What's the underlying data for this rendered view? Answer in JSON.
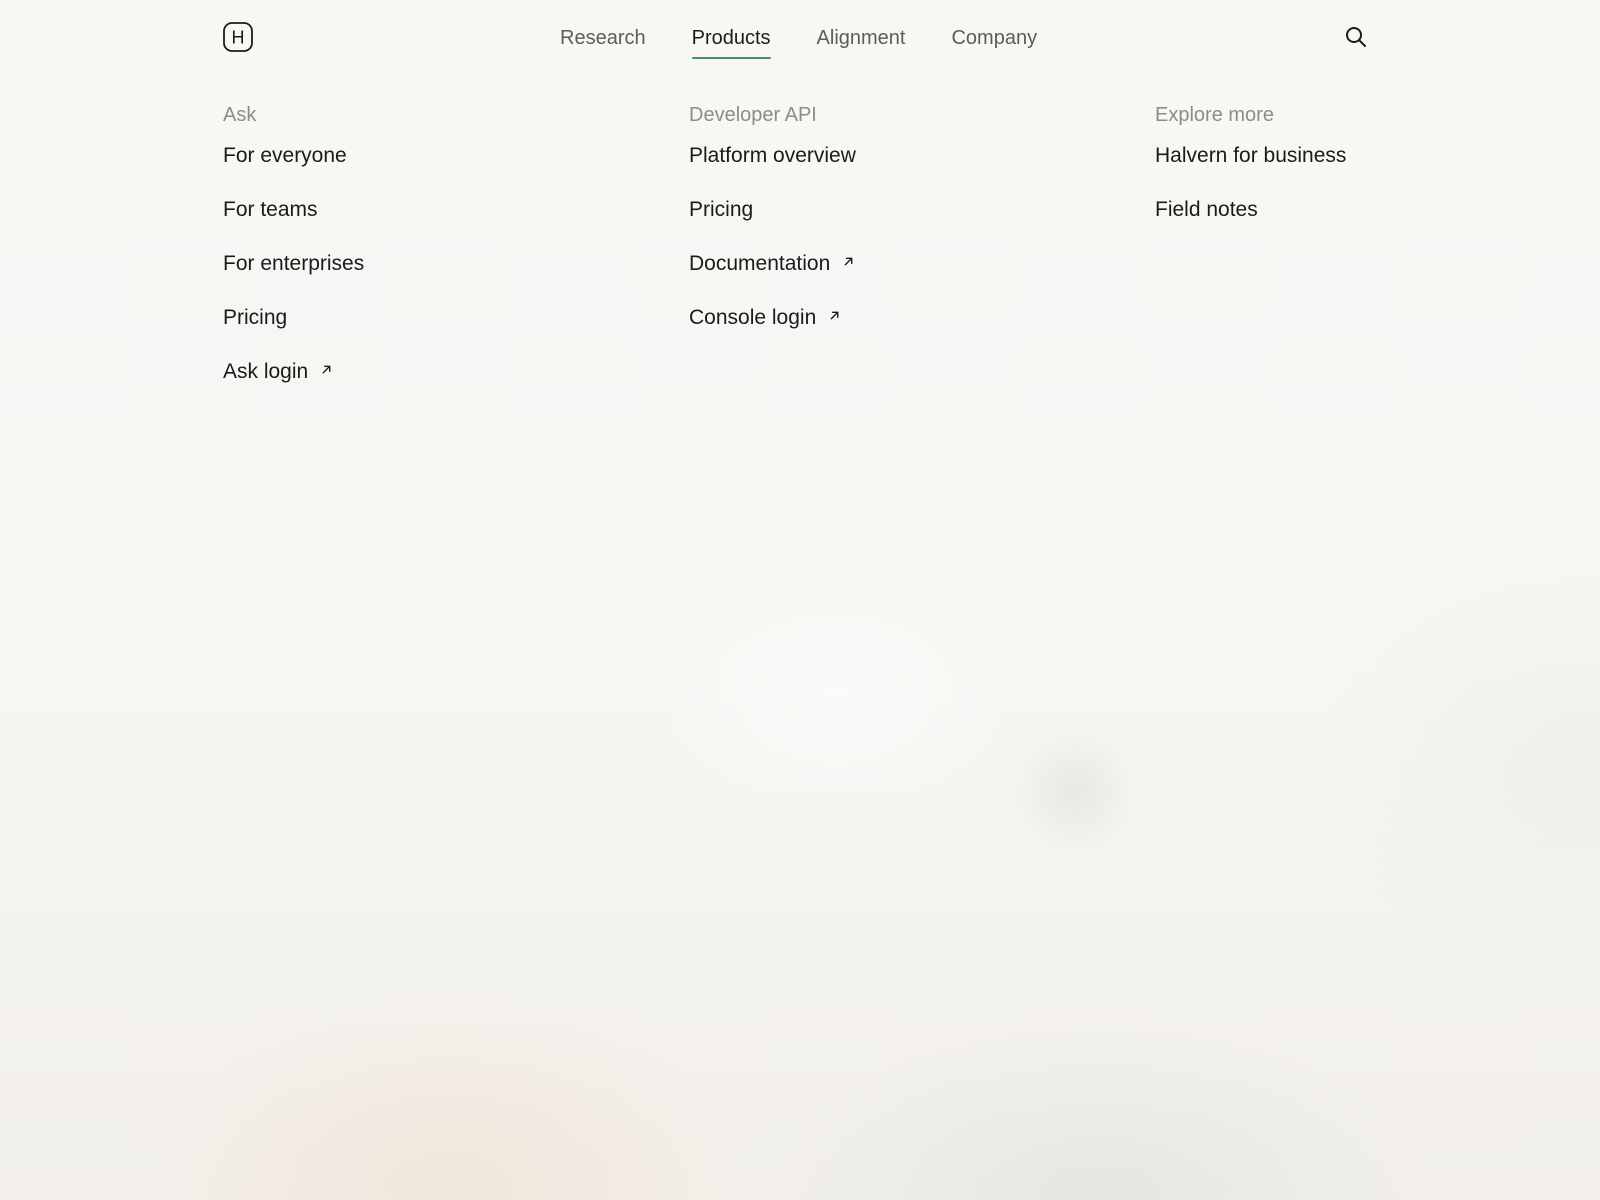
{
  "brand": {
    "logo_letter": "H"
  },
  "nav": {
    "items": [
      {
        "label": "Research",
        "active": false
      },
      {
        "label": "Products",
        "active": true
      },
      {
        "label": "Alignment",
        "active": false
      },
      {
        "label": "Company",
        "active": false
      }
    ],
    "search_icon": "search-icon",
    "accent_color": "#4f8a6d"
  },
  "menu": {
    "columns": [
      {
        "heading": "Ask",
        "links": [
          {
            "label": "For everyone",
            "external": false
          },
          {
            "label": "For teams",
            "external": false
          },
          {
            "label": "For enterprises",
            "external": false
          },
          {
            "label": "Pricing",
            "external": false
          },
          {
            "label": "Ask login",
            "external": true
          }
        ]
      },
      {
        "heading": "Developer API",
        "links": [
          {
            "label": "Platform overview",
            "external": false
          },
          {
            "label": "Pricing",
            "external": false
          },
          {
            "label": "Documentation",
            "external": true
          },
          {
            "label": "Console login",
            "external": true
          }
        ]
      },
      {
        "heading": "Explore more",
        "links": [
          {
            "label": "Halvern for business",
            "external": false
          },
          {
            "label": "Field notes",
            "external": false
          }
        ]
      }
    ],
    "external_icon": "external-link-arrow-icon"
  },
  "colors": {
    "page_background": "#f7f6f3",
    "text": "#1b1b19",
    "muted_text": "#8d8c88",
    "nav_text": "#5c5c58"
  }
}
